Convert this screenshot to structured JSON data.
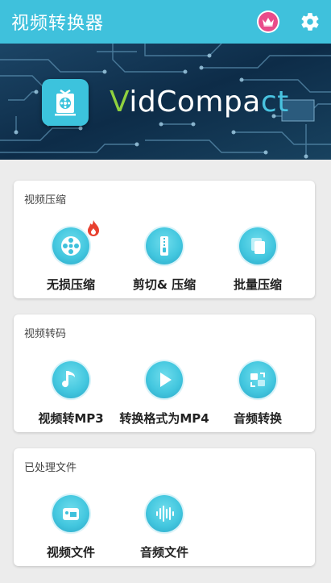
{
  "appbar": {
    "title": "视频转换器",
    "crown_icon": "crown-icon",
    "settings_icon": "gear-icon"
  },
  "banner": {
    "brand_v": "V",
    "brand_mid": "idCompa",
    "brand_act": "ct"
  },
  "sections": [
    {
      "title": "视频压缩",
      "items": [
        {
          "label": "无损压缩",
          "icon": "film-reel-icon",
          "badge": "fire-icon"
        },
        {
          "label": "剪切& 压缩",
          "icon": "zipper-icon"
        },
        {
          "label": "批量压缩",
          "icon": "copy-icon"
        }
      ]
    },
    {
      "title": "视频转码",
      "items": [
        {
          "label": "视频转MP3",
          "icon": "music-note-icon"
        },
        {
          "label": "转换格式为MP4",
          "icon": "play-icon"
        },
        {
          "label": "音频转换",
          "icon": "convert-arrows-icon"
        }
      ]
    },
    {
      "title": "已处理文件",
      "items": [
        {
          "label": "视频文件",
          "icon": "video-camera-icon"
        },
        {
          "label": "音频文件",
          "icon": "sound-wave-icon"
        }
      ]
    }
  ],
  "colors": {
    "accent": "#3fc1dc",
    "crown": "#e94b8a",
    "brand_green": "#8fd13f"
  }
}
